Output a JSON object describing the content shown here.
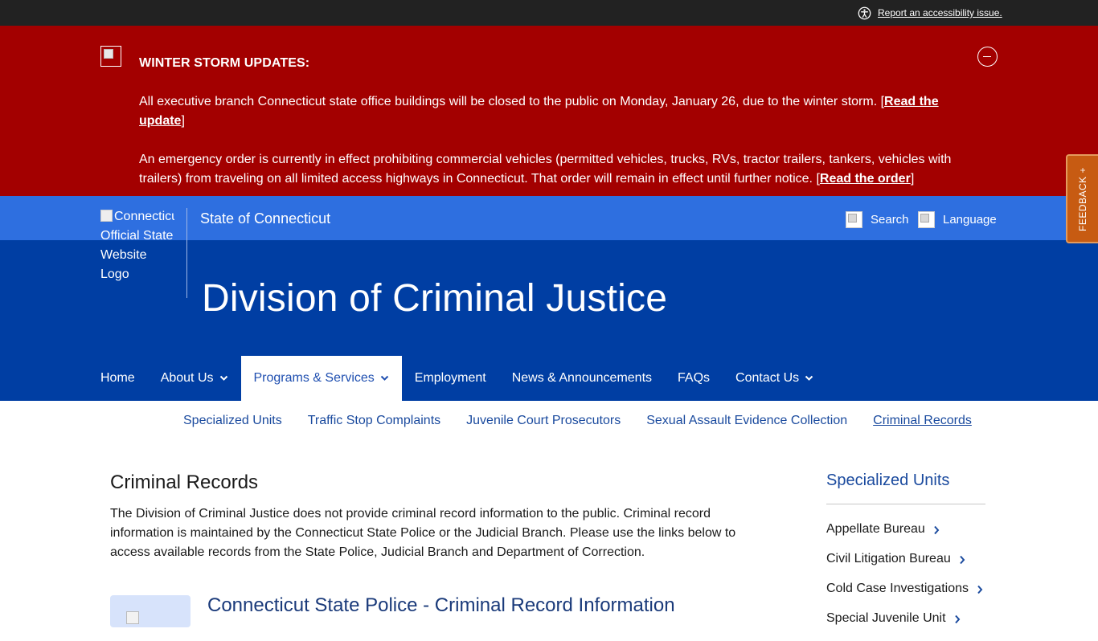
{
  "utility": {
    "accessibility_link": "Report an accessibility issue."
  },
  "alert": {
    "title": "WINTER STORM UPDATES:",
    "p1_text": "All executive branch Connecticut state office buildings will be closed to the public on Monday, January 26, due to the winter storm. [",
    "p1_link": "Read the update",
    "p1_end": "]",
    "p2_text": "An emergency order is currently in effect prohibiting commercial vehicles (permitted vehicles, trucks, RVs, tractor trailers, tankers, vehicles with trailers) from traveling on all limited access highways in Connecticut. That order will remain in effect until further notice. [",
    "p2_link": "Read the order",
    "p2_end": "]"
  },
  "header": {
    "logo_alt": "Connecticut's Official State Website Logo",
    "logo_alt_line1": "Connecticut's",
    "logo_alt_rest": "Official State Website Logo",
    "state_name": "State of Connecticut",
    "search_label": "Search",
    "language_label": "Language",
    "site_title": "Division of Criminal Justice"
  },
  "feedback": {
    "label": "FEEDBACK +"
  },
  "nav": {
    "items": [
      {
        "label": "Home"
      },
      {
        "label": "About Us"
      },
      {
        "label": "Programs & Services"
      },
      {
        "label": "Employment"
      },
      {
        "label": "News & Announcements"
      },
      {
        "label": "FAQs"
      },
      {
        "label": "Contact Us"
      }
    ]
  },
  "subnav": {
    "items": [
      {
        "label": "Specialized Units"
      },
      {
        "label": "Traffic Stop Complaints"
      },
      {
        "label": "Juvenile Court Prosecutors"
      },
      {
        "label": "Sexual Assault Evidence Collection"
      },
      {
        "label": "Criminal Records"
      }
    ]
  },
  "main": {
    "title": "Criminal Records",
    "intro": "The Division of Criminal Justice does not provide criminal record information to the public. Criminal record information is maintained by the Connecticut State Police or the Judicial Branch. Please use the links below to access available records from the State Police, Judicial Branch and Department of Correction.",
    "card_title": "Connecticut State Police - Criminal Record Information"
  },
  "sidebar": {
    "heading": "Specialized Units",
    "items": [
      {
        "label": "Appellate Bureau"
      },
      {
        "label": "Civil Litigation Bureau"
      },
      {
        "label": "Cold Case Investigations"
      },
      {
        "label": "Special Juvenile Unit"
      }
    ]
  },
  "colors": {
    "alert_bg": "#a30000",
    "header_top": "#2e6fe0",
    "header_main": "#003ea3",
    "feedback_bg": "#c75b12",
    "link_blue": "#1a4a9e"
  }
}
